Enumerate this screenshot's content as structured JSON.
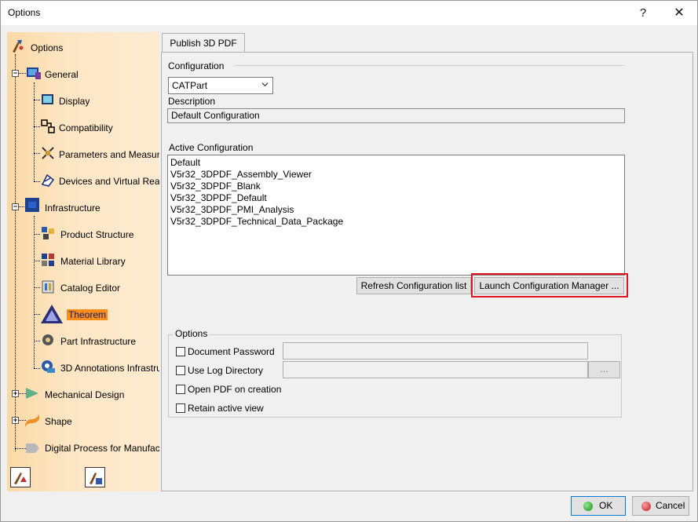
{
  "window": {
    "title": "Options",
    "help_glyph": "?",
    "close_glyph": "✕"
  },
  "tree": {
    "root": "Options",
    "items": [
      {
        "label": "General"
      },
      {
        "label": "Display"
      },
      {
        "label": "Compatibility"
      },
      {
        "label": "Parameters and Measure"
      },
      {
        "label": "Devices and Virtual Reali"
      },
      {
        "label": "Infrastructure"
      },
      {
        "label": "Product Structure"
      },
      {
        "label": "Material Library"
      },
      {
        "label": "Catalog Editor"
      },
      {
        "label": "Theorem"
      },
      {
        "label": "Part Infrastructure"
      },
      {
        "label": "3D Annotations Infrastru"
      },
      {
        "label": "Mechanical Design"
      },
      {
        "label": "Shape"
      },
      {
        "label": "Digital Process for Manufact"
      }
    ],
    "selected": "Theorem"
  },
  "tab": {
    "label": "Publish 3D PDF"
  },
  "configuration": {
    "label": "Configuration",
    "selected": "CATPart",
    "description_label": "Description",
    "description_value": "Default Configuration"
  },
  "active_configuration": {
    "label": "Active Configuration",
    "items": [
      "Default",
      "V5r32_3DPDF_Assembly_Viewer",
      "V5r32_3DPDF_Blank",
      "V5r32_3DPDF_Default",
      "V5r32_3DPDF_PMI_Analysis",
      "V5r32_3DPDF_Technical_Data_Package"
    ]
  },
  "buttons": {
    "refresh": "Refresh Configuration list",
    "launch": "Launch Configuration Manager ...",
    "browse": "...",
    "ok": "OK",
    "cancel": "Cancel"
  },
  "options": {
    "title": "Options",
    "document_password": "Document Password",
    "use_log_directory": "Use Log Directory",
    "open_pdf": "Open PDF on creation",
    "retain_view": "Retain active view"
  },
  "colors": {
    "highlight": "#e0141e",
    "selected_bg": "#ff8b1a"
  }
}
